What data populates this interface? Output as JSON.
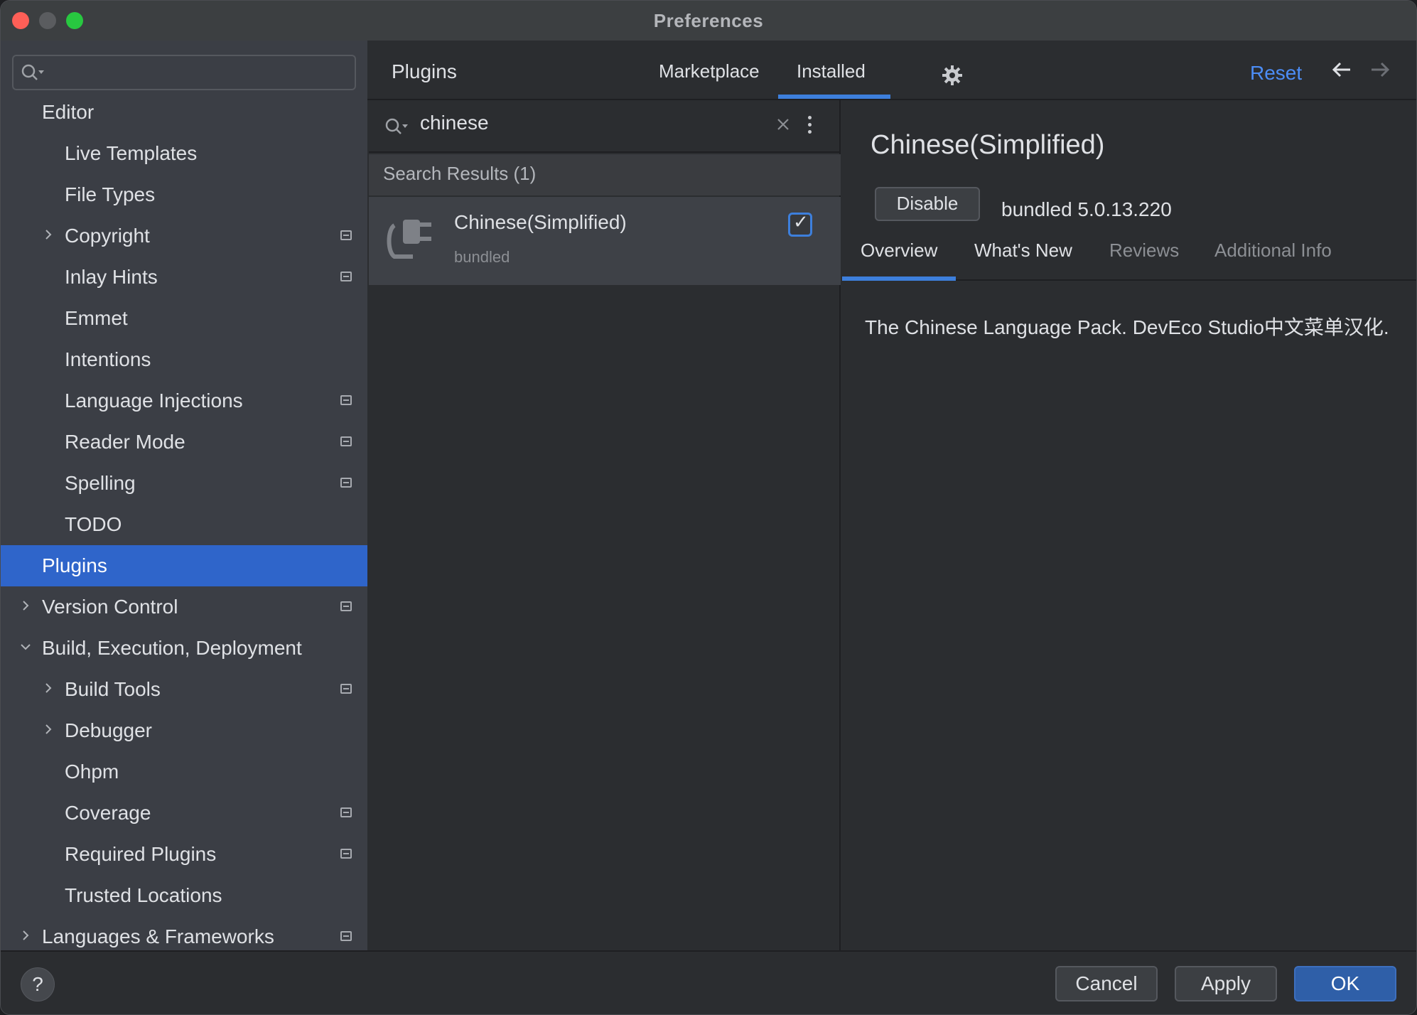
{
  "window": {
    "title": "Preferences"
  },
  "sidebar": {
    "search_placeholder": "",
    "items": [
      {
        "label": "Editor",
        "level": 0,
        "chevron": "",
        "badge": false,
        "selected": false
      },
      {
        "label": "Live Templates",
        "level": 1,
        "chevron": "",
        "badge": false,
        "selected": false
      },
      {
        "label": "File Types",
        "level": 1,
        "chevron": "",
        "badge": false,
        "selected": false
      },
      {
        "label": "Copyright",
        "level": 1,
        "chevron": "right",
        "badge": true,
        "selected": false
      },
      {
        "label": "Inlay Hints",
        "level": 1,
        "chevron": "",
        "badge": true,
        "selected": false
      },
      {
        "label": "Emmet",
        "level": 1,
        "chevron": "",
        "badge": false,
        "selected": false
      },
      {
        "label": "Intentions",
        "level": 1,
        "chevron": "",
        "badge": false,
        "selected": false
      },
      {
        "label": "Language Injections",
        "level": 1,
        "chevron": "",
        "badge": true,
        "selected": false
      },
      {
        "label": "Reader Mode",
        "level": 1,
        "chevron": "",
        "badge": true,
        "selected": false
      },
      {
        "label": "Spelling",
        "level": 1,
        "chevron": "",
        "badge": true,
        "selected": false
      },
      {
        "label": "TODO",
        "level": 1,
        "chevron": "",
        "badge": false,
        "selected": false
      },
      {
        "label": "Plugins",
        "level": 0,
        "chevron": "",
        "badge": false,
        "selected": true
      },
      {
        "label": "Version Control",
        "level": 0,
        "chevron": "right",
        "badge": true,
        "selected": false
      },
      {
        "label": "Build, Execution, Deployment",
        "level": 0,
        "chevron": "down",
        "badge": false,
        "selected": false
      },
      {
        "label": "Build Tools",
        "level": 1,
        "chevron": "right",
        "badge": true,
        "selected": false
      },
      {
        "label": "Debugger",
        "level": 1,
        "chevron": "right",
        "badge": false,
        "selected": false
      },
      {
        "label": "Ohpm",
        "level": 1,
        "chevron": "",
        "badge": false,
        "selected": false
      },
      {
        "label": "Coverage",
        "level": 1,
        "chevron": "",
        "badge": true,
        "selected": false
      },
      {
        "label": "Required Plugins",
        "level": 1,
        "chevron": "",
        "badge": true,
        "selected": false
      },
      {
        "label": "Trusted Locations",
        "level": 1,
        "chevron": "",
        "badge": false,
        "selected": false
      },
      {
        "label": "Languages & Frameworks",
        "level": 0,
        "chevron": "right",
        "badge": true,
        "selected": false
      }
    ]
  },
  "header": {
    "title": "Plugins",
    "tabs": [
      {
        "label": "Marketplace"
      },
      {
        "label": "Installed"
      }
    ],
    "active_tab": "Installed",
    "reset_label": "Reset",
    "gear_icon": "gear-icon",
    "back_icon": "arrow-left-icon",
    "forward_icon": "arrow-right-icon"
  },
  "plugin_list": {
    "search_value": "chinese",
    "results_header": "Search Results (1)",
    "plugins": [
      {
        "name": "Chinese(Simplified)",
        "subtitle": "bundled",
        "enabled": true
      }
    ]
  },
  "detail": {
    "name": "Chinese(Simplified)",
    "disable_label": "Disable",
    "version": "bundled 5.0.13.220",
    "tabs": [
      "Overview",
      "What's New",
      "Reviews",
      "Additional Info"
    ],
    "active_tab": "Overview",
    "description": "The Chinese Language Pack. DevEco Studio中文菜单汉化."
  },
  "footer": {
    "help_label": "?",
    "cancel_label": "Cancel",
    "apply_label": "Apply",
    "ok_label": "OK"
  },
  "colors": {
    "accent": "#3d7fdc",
    "selection": "#2f65ca",
    "link": "#4c8df6",
    "close": "#fe5f57",
    "maximize": "#28c840"
  }
}
